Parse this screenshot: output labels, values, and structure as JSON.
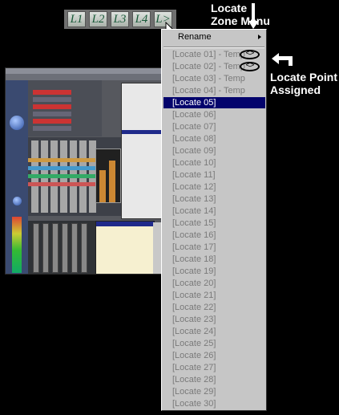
{
  "locate_buttons": [
    "L1",
    "L2",
    "L3",
    "L4",
    "L>"
  ],
  "annotations": {
    "zone_menu": [
      "Locate",
      "Zone Menu"
    ],
    "point_assigned": [
      "Locate Point",
      "Assigned"
    ]
  },
  "menu": {
    "rename_label": "Rename",
    "items": [
      "[Locate 01] - Temp",
      "[Locate 02] - Temp",
      "[Locate 03] - Temp",
      "[Locate 04] - Temp",
      "[Locate 05]",
      "[Locate 06]",
      "[Locate 07]",
      "[Locate 08]",
      "[Locate 09]",
      "[Locate 10]",
      "[Locate 11]",
      "[Locate 12]",
      "[Locate 13]",
      "[Locate 14]",
      "[Locate 15]",
      "[Locate 16]",
      "[Locate 17]",
      "[Locate 18]",
      "[Locate 19]",
      "[Locate 20]",
      "[Locate 21]",
      "[Locate 22]",
      "[Locate 23]",
      "[Locate 24]",
      "[Locate 25]",
      "[Locate 26]",
      "[Locate 27]",
      "[Locate 28]",
      "[Locate 29]",
      "[Locate 30]"
    ],
    "selected_index": 4,
    "assigned_marker": "<>"
  },
  "colors": {
    "menu_bg": "#c6c6c6",
    "selection": "#04046c",
    "item_text": "#7a7a7a",
    "background": "#000000"
  }
}
